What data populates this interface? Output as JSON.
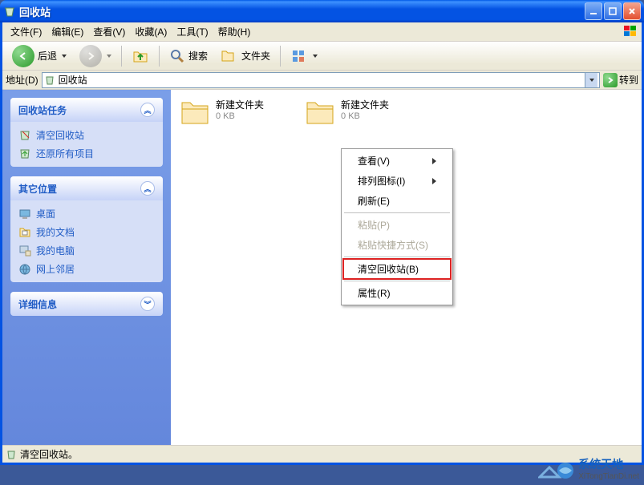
{
  "window": {
    "title": "回收站"
  },
  "menu": {
    "file": "文件(F)",
    "edit": "编辑(E)",
    "view": "查看(V)",
    "favorites": "收藏(A)",
    "tools": "工具(T)",
    "help": "帮助(H)"
  },
  "toolbar": {
    "back": "后退",
    "search": "搜索",
    "folders": "文件夹"
  },
  "addressbar": {
    "label": "地址(D)",
    "value": "回收站",
    "go": "转到"
  },
  "sidebar": {
    "tasks": {
      "title": "回收站任务",
      "items": [
        {
          "icon": "empty-recycle",
          "label": "清空回收站"
        },
        {
          "icon": "restore-all",
          "label": "还原所有项目"
        }
      ]
    },
    "places": {
      "title": "其它位置",
      "items": [
        {
          "icon": "desktop",
          "label": "桌面"
        },
        {
          "icon": "my-docs",
          "label": "我的文档"
        },
        {
          "icon": "my-computer",
          "label": "我的电脑"
        },
        {
          "icon": "network",
          "label": "网上邻居"
        }
      ]
    },
    "details": {
      "title": "详细信息"
    }
  },
  "files": [
    {
      "name": "新建文件夹",
      "meta": "0 KB"
    },
    {
      "name": "新建文件夹",
      "meta": "0 KB"
    }
  ],
  "context_menu": {
    "view": "查看(V)",
    "arrange": "排列图标(I)",
    "refresh": "刷新(E)",
    "paste": "粘贴(P)",
    "paste_shortcut": "粘贴快捷方式(S)",
    "empty": "清空回收站(B)",
    "properties": "属性(R)"
  },
  "statusbar": {
    "text": "清空回收站。"
  },
  "watermark": {
    "line1": "系统天地",
    "line2": "XiTongTianDi.net"
  }
}
